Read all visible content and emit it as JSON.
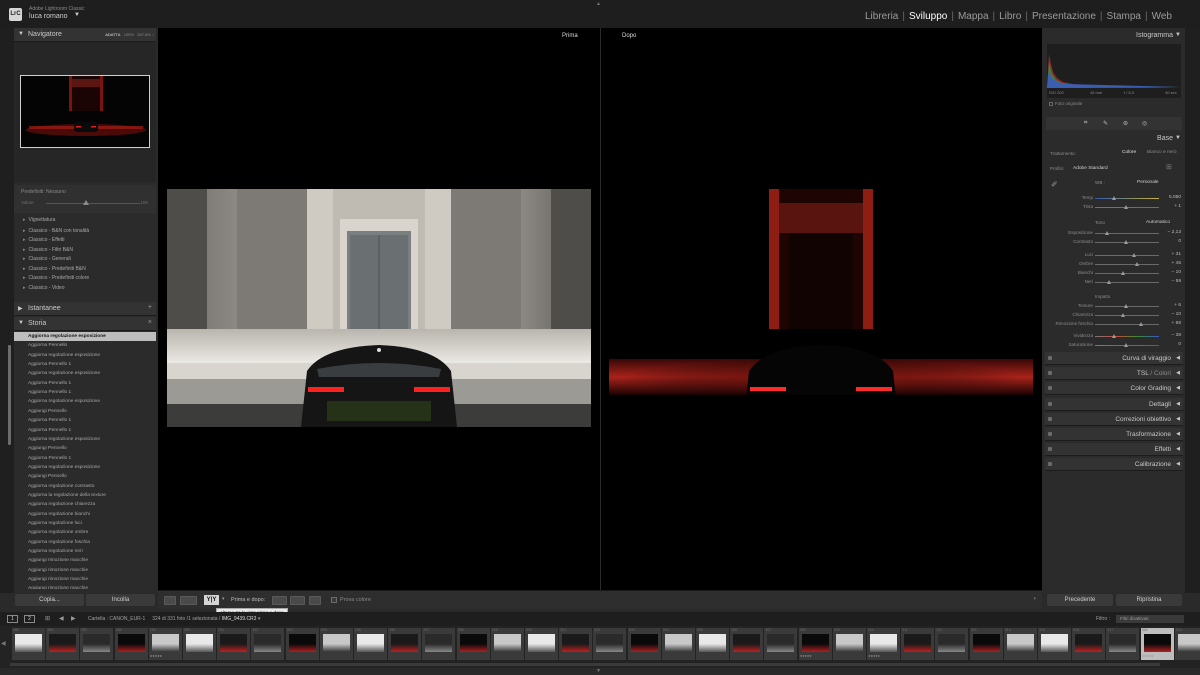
{
  "app": {
    "logo_text": "LrC",
    "app_name": "Adobe Lightroom Classic",
    "user_name": "luca romano",
    "modules": [
      "Libreria",
      "Sviluppo",
      "Mappa",
      "Libro",
      "Presentazione",
      "Stampa",
      "Web"
    ],
    "active_module": "Sviluppo"
  },
  "left_panel": {
    "navigator": {
      "title": "Navigatore",
      "zoom_options": [
        "ADATTA",
        "100%",
        "267.6%"
      ]
    },
    "preset_amount": {
      "title": "Predefiniti: Nessuno",
      "label": "Valore",
      "value": "100"
    },
    "presets": [
      "Vignettatura",
      "Classico - B&N con tonalità",
      "Classico - Effetti",
      "Classico - Filtri B&N",
      "Classico - Generali",
      "Classico - Predefiniti B&N",
      "Classico - Predefiniti colore",
      "Classico - Video"
    ],
    "snapshots": {
      "title": "Istantanee"
    },
    "history": {
      "title": "Storia",
      "items": [
        "Aggiorna regolazione esposizione",
        "Aggiorna Pennello",
        "Aggiorna regolazione esposizione",
        "Aggiorna Pennello 1",
        "Aggiorna regolazione esposizione",
        "Aggiorna Pennello 1",
        "Aggiorna Pennello 1",
        "Aggiorna regolazione esposizione",
        "Aggiungi Pennello",
        "Aggiorna Pennello 1",
        "Aggiorna Pennello 1",
        "Aggiorna regolazione esposizione",
        "Aggiungi Pennello",
        "Aggiorna Pennello 1",
        "Aggiorna regolazione esposizione",
        "Aggiungi Pennello",
        "Aggiorna regolazione contrasto",
        "Aggiorna la regolazione della texture",
        "Aggiorna regolazione chiarezza",
        "Aggiorna regolazione bianchi",
        "Aggiorna regolazione luci",
        "Aggiorna regolazione ombre",
        "Aggiorna regolazione foschia",
        "Aggiorna regolazione neri",
        "Aggiungi rimozione macchie",
        "Aggiungi rimozione macchie",
        "Aggiungi rimozione macchie",
        "Aggiungi rimozione macchie"
      ],
      "selected_index": 0
    },
    "copy_label": "Copia...",
    "paste_label": "Incolla"
  },
  "center": {
    "before_label": "Prima",
    "after_label": "Dopo"
  },
  "toolbar": {
    "yy_label": "Y|Y",
    "before_after_label": "Prima e dopo:",
    "proof_label": "Prova colore",
    "tooltip": "Alterna tra le viste prima e dopo"
  },
  "right_panel": {
    "histogram": {
      "title": "Istogramma",
      "iso": "ISO 200",
      "focal": "45 mm",
      "aperture": "f / 6,3",
      "shutter": "40 sec",
      "original_photo_label": "Foto originale"
    },
    "basic": {
      "title": "Base",
      "treatment_label": "Trattamento:",
      "treatment_color": "Colore",
      "treatment_bw": "Bianco e nero",
      "profile_label": "Profilo:",
      "profile_value": "Adobe Standard",
      "wb_label": "WB :",
      "wb_value": "Personale",
      "temp_label": "Temp",
      "temp_value": "5.050",
      "tint_label": "Tinta",
      "tint_value": "+ 1",
      "tone_label": "Tono",
      "tone_auto": "Automatico",
      "exposure_label": "Esposizione",
      "exposure_value": "− 2,13",
      "contrast_label": "Contrasto",
      "contrast_value": "0",
      "highlights_label": "Luci",
      "highlights_value": "+ 31",
      "shadows_label": "Ombre",
      "shadows_value": "+ 45",
      "whites_label": "Bianchi",
      "whites_value": "− 10",
      "blacks_label": "Neri",
      "blacks_value": "− 59",
      "presence_label": "Impatto",
      "texture_label": "Texture",
      "texture_value": "+ 6",
      "clarity_label": "Chiarezza",
      "clarity_value": "− 10",
      "dehaze_label": "Rimozione foschia",
      "dehaze_value": "+ 68",
      "vibrance_label": "Vividezza",
      "vibrance_value": "− 38",
      "saturation_label": "Saturazione",
      "saturation_value": "0"
    },
    "sections": [
      "Curva di viraggio",
      "TSL",
      "Color Grading",
      "Dettagli",
      "Correzioni obiettivo",
      "Trasformazione",
      "Effetti",
      "Calibrazione"
    ],
    "tsl_sub": "/ Colori",
    "prev_label": "Precedente",
    "reset_label": "Ripristina"
  },
  "filmstrip": {
    "page_buttons": [
      "1",
      "2"
    ],
    "path_prefix": "Cartella : CANON_EUR-1",
    "count": "324 di 331 foto /1 selezionata /",
    "filename": "IMG_9439.CR3",
    "filter_label": "Filtro :",
    "filter_value": "Filtri disattivati",
    "frame_numbers": [
      "285",
      "286",
      "287",
      "288",
      "289",
      "290",
      "291",
      "292",
      "293",
      "294",
      "295",
      "296",
      "297",
      "298",
      "299",
      "300",
      "301",
      "302",
      "303",
      "304",
      "305",
      "306",
      "307",
      "308",
      "309",
      "310",
      "311",
      "312",
      "313",
      "314",
      "315",
      "316",
      "317",
      "318",
      "319"
    ],
    "selected_frame": "318",
    "stars": "★★★★★"
  },
  "icons": {
    "collapse": "triangle-down-icon",
    "plus": "plus-icon",
    "close": "close-icon"
  },
  "colors": {
    "accent_red": "#c0161a",
    "panel_bg": "#2b2b2b",
    "active_text": "#ffffff"
  }
}
